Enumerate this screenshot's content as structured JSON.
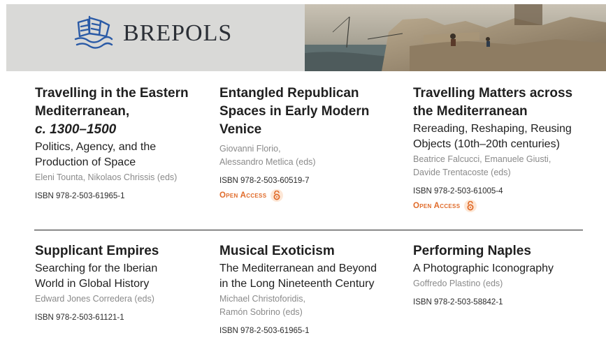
{
  "header": {
    "brand": "BREPOLS"
  },
  "books": [
    {
      "title_lines": [
        "Travelling in the Eastern",
        "Mediterranean,",
        "c. 1300–1500"
      ],
      "subtitle_lines": [
        "Politics, Agency, and the",
        "Production of Space"
      ],
      "editors_lines": [
        "Eleni Tounta, Nikolaos Chrissis (eds)"
      ],
      "isbn": "ISBN 978-2-503-61965-1"
    },
    {
      "title_lines": [
        "Entangled Republican",
        "Spaces in Early Modern",
        "Venice"
      ],
      "subtitle_lines": [],
      "editors_lines": [
        "Giovanni Florio,",
        "Alessandro Metlica (eds)"
      ],
      "isbn": "ISBN 978-2-503-60519-7",
      "open_access": "Open Access"
    },
    {
      "title_lines": [
        "Travelling Matters across",
        "the Mediterranean"
      ],
      "subtitle_lines": [
        "Rereading, Reshaping, Reusing",
        "Objects (10th–20th centuries)"
      ],
      "editors_lines": [
        "Beatrice Falcucci, Emanuele Giusti,",
        "Davide Trentacoste (eds)"
      ],
      "isbn": "ISBN 978-2-503-61005-4",
      "open_access": "Open Access"
    },
    {
      "title_lines": [
        "Supplicant Empires"
      ],
      "subtitle_lines": [
        "Searching for the Iberian",
        "World in Global History"
      ],
      "editors_lines": [
        "Edward Jones Corredera (eds)"
      ],
      "isbn": "ISBN 978-2-503-61121-1"
    },
    {
      "title_lines": [
        "Musical Exoticism"
      ],
      "subtitle_lines": [
        "The Mediterranean and Beyond",
        "in the Long Nineteenth Century"
      ],
      "editors_lines": [
        "Michael Christoforidis,",
        "Ramón Sobrino (eds)"
      ],
      "isbn": "ISBN 978-2-503-61965-1"
    },
    {
      "title_lines": [
        "Performing Naples"
      ],
      "subtitle_lines": [
        "A Photographic Iconography"
      ],
      "editors_lines": [
        "Goffredo Plastino (eds)"
      ],
      "isbn": "ISBN 978-2-503-58842-1"
    }
  ]
}
